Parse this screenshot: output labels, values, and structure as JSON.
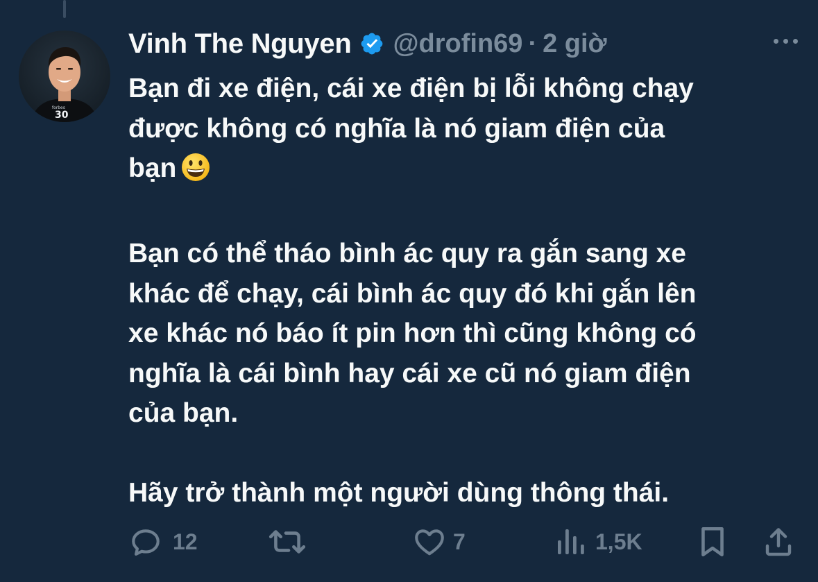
{
  "tweet": {
    "display_name": "Vinh The Nguyen",
    "handle": "@drofin69",
    "separator": "·",
    "time": "2 giờ",
    "paragraphs": [
      [
        "Bạn đi xe điện, cái xe điện bị lỗi không chạy",
        "được không có nghĩa là nó giam điện của",
        "bạn"
      ],
      [
        "Bạn có thể tháo bình ác quy ra gắn sang xe",
        "khác để chạy, cái bình ác quy đó khi gắn lên",
        "xe khác nó báo ít pin hơn thì cũng không có",
        "nghĩa là cái bình hay cái xe cũ nó giam điện",
        "của bạn."
      ],
      [
        "Hãy trở thành một người dùng thông thái."
      ]
    ],
    "emoji": "grinning-face",
    "avatar_shirt_text": "30"
  },
  "actions": {
    "replies": "12",
    "retweets": "",
    "likes": "7",
    "views": "1,5K"
  },
  "colors": {
    "background": "#15283d",
    "text": "#f7f9f9",
    "muted": "#7b8c9c",
    "verified": "#1d9bf0"
  },
  "icons": [
    "verified-badge-icon",
    "more-icon",
    "reply-icon",
    "retweet-icon",
    "like-icon",
    "views-icon",
    "bookmark-icon",
    "share-icon"
  ]
}
